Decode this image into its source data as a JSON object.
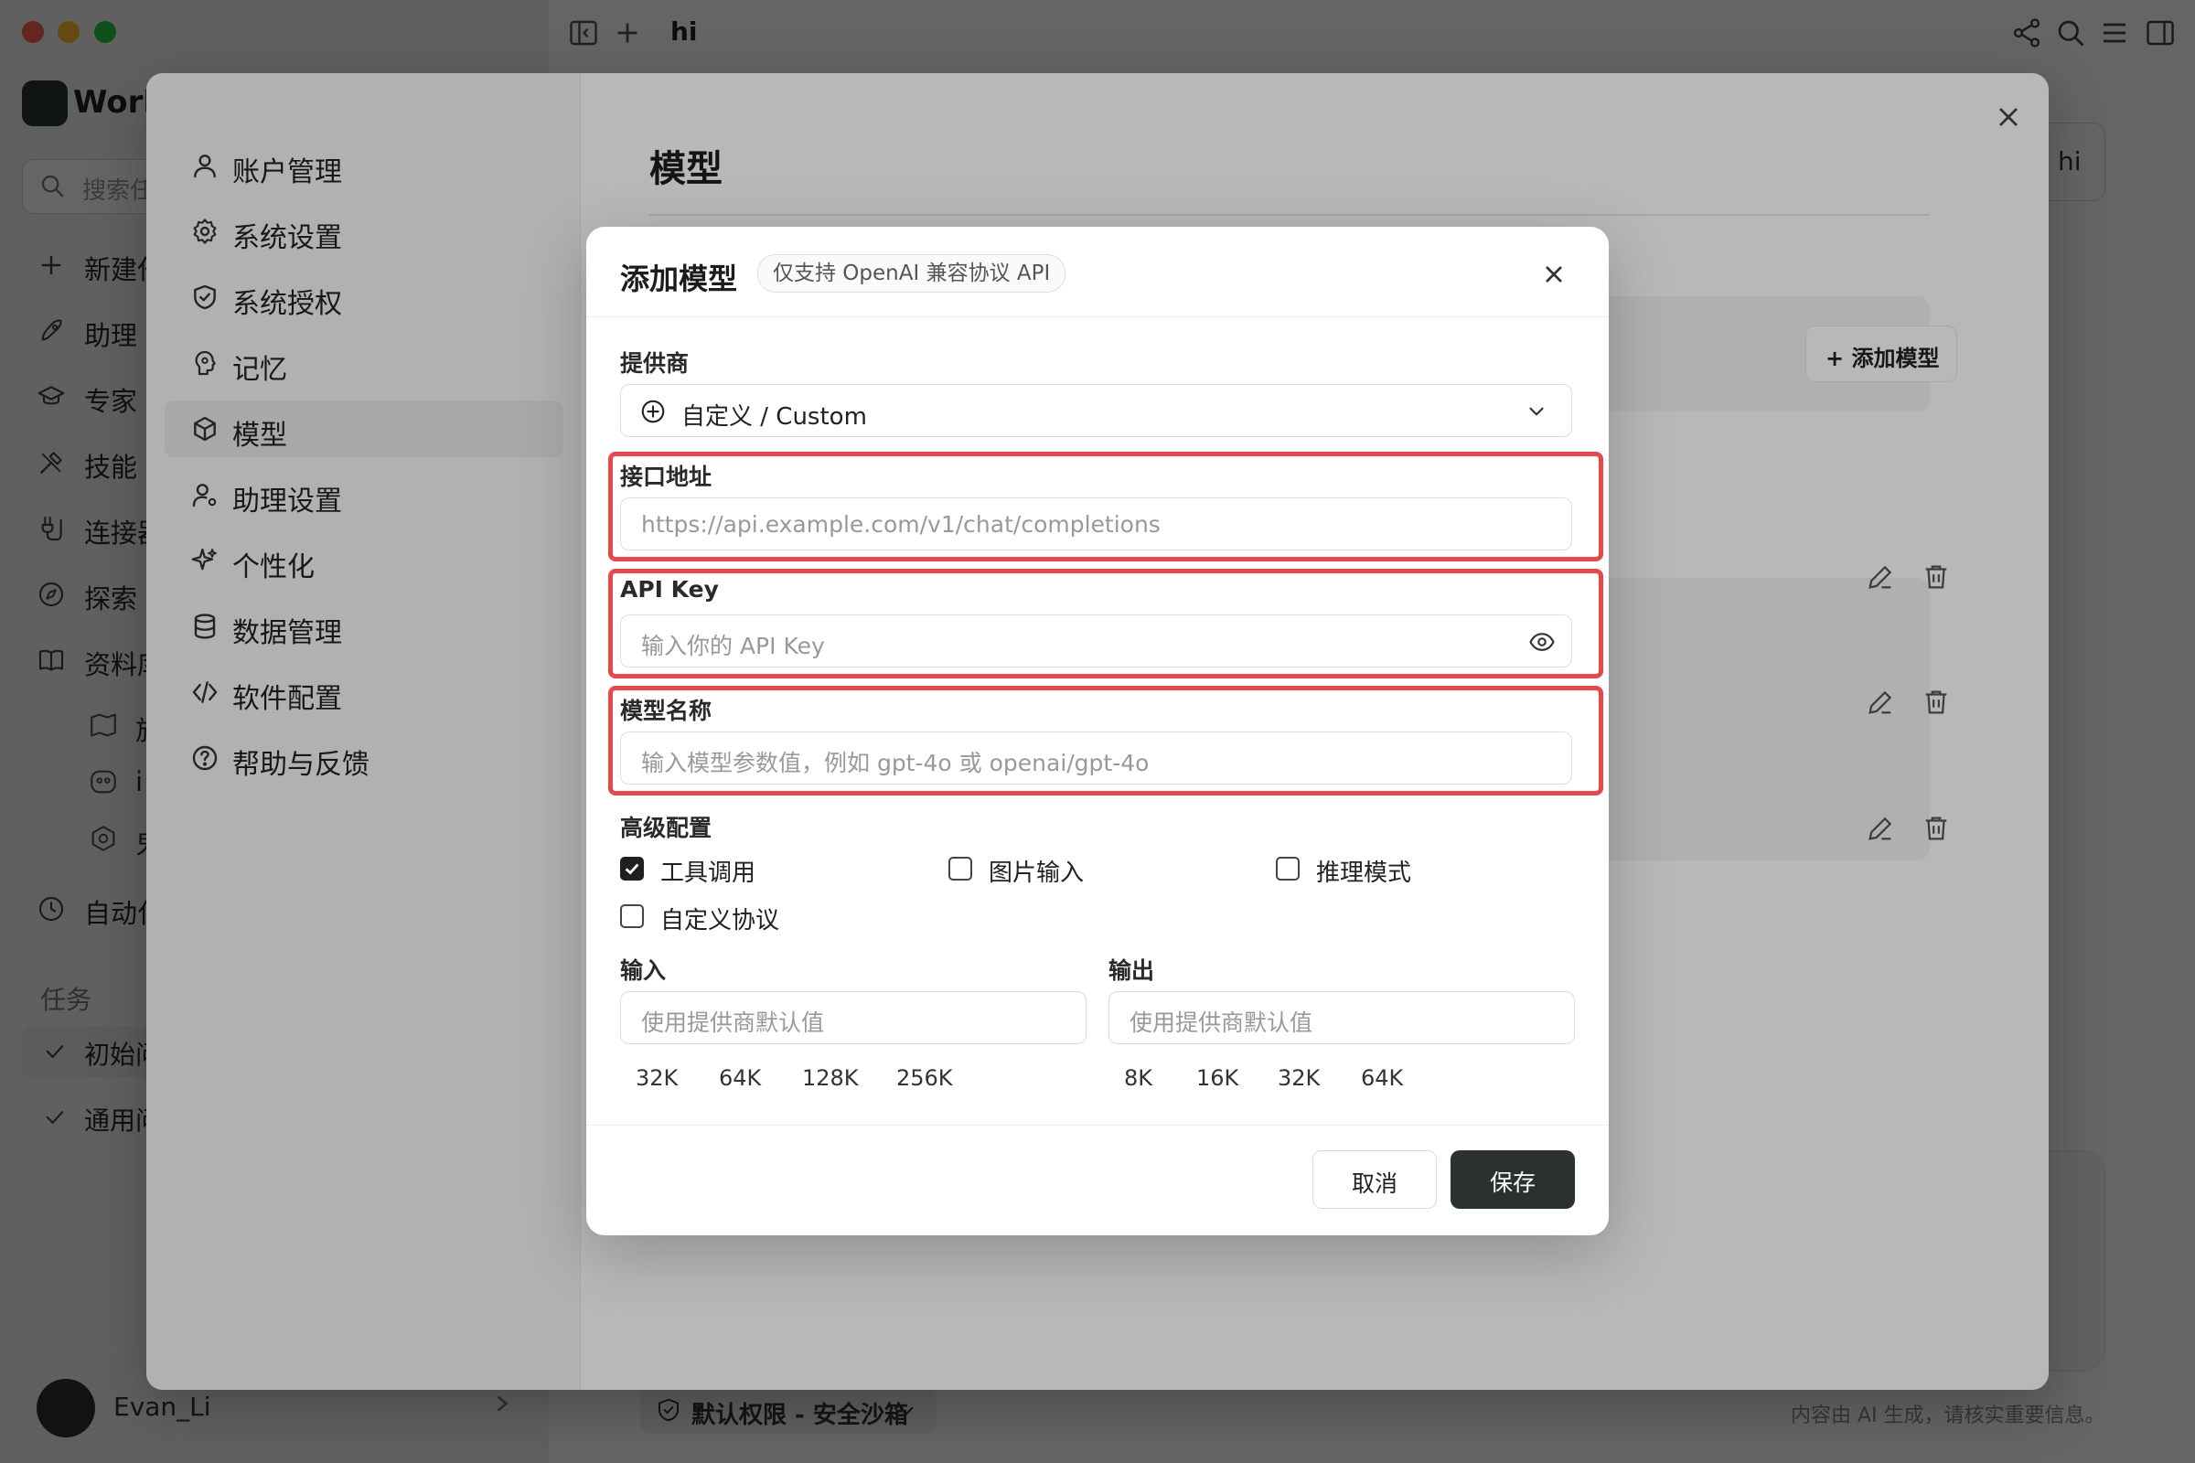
{
  "titlebar": {
    "tab_title": "hi"
  },
  "app_sidebar": {
    "brand": "Work",
    "search_placeholder": "搜索任",
    "nav": [
      {
        "label": "新建任",
        "icon": "plus-icon"
      },
      {
        "label": "助理",
        "icon": "rocket-icon"
      },
      {
        "label": "专家",
        "icon": "graduation-cap-icon"
      },
      {
        "label": "技能",
        "icon": "tools-icon"
      },
      {
        "label": "连接器",
        "icon": "plug-icon"
      },
      {
        "label": "探索",
        "icon": "compass-icon"
      },
      {
        "label": "资料库",
        "icon": "book-icon"
      }
    ],
    "sub_items": [
      "旅",
      "i",
      "鬼"
    ],
    "automation": "自动化",
    "tasks_label": "任务",
    "tasks": [
      "初始问",
      "通用问"
    ],
    "user_name": "Evan_Li"
  },
  "main": {
    "hi_label": "hi",
    "permission": "默认权限 - 安全沙箱",
    "disclaimer": "内容由 AI 生成，请核实重要信息。"
  },
  "settings": {
    "title": "模型",
    "add_model_label": "+ 添加模型",
    "menu": [
      {
        "label": "账户管理",
        "icon": "user-icon",
        "active": false
      },
      {
        "label": "系统设置",
        "icon": "gear-icon",
        "active": false
      },
      {
        "label": "系统授权",
        "icon": "shield-check-icon",
        "active": false
      },
      {
        "label": "记忆",
        "icon": "brain-icon",
        "active": false
      },
      {
        "label": "模型",
        "icon": "cube-icon",
        "active": true
      },
      {
        "label": "助理设置",
        "icon": "user-cog-icon",
        "active": false
      },
      {
        "label": "个性化",
        "icon": "sparkles-icon",
        "active": false
      },
      {
        "label": "数据管理",
        "icon": "database-icon",
        "active": false
      },
      {
        "label": "软件配置",
        "icon": "code-icon",
        "active": false
      },
      {
        "label": "帮助与反馈",
        "icon": "help-circle-icon",
        "active": false
      }
    ]
  },
  "dialog": {
    "title": "添加模型",
    "badge": "仅支持 OpenAI 兼容协议 API",
    "provider_label": "提供商",
    "provider_value": "自定义 / Custom",
    "endpoint_label": "接口地址",
    "endpoint_placeholder": "https://api.example.com/v1/chat/completions",
    "apikey_label": "API Key",
    "apikey_placeholder": "输入你的 API Key",
    "model_name_label": "模型名称",
    "model_name_placeholder": "输入模型参数值，例如 gpt-4o 或 openai/gpt-4o",
    "advanced_label": "高级配置",
    "options": [
      {
        "label": "工具调用",
        "checked": true
      },
      {
        "label": "图片输入",
        "checked": false
      },
      {
        "label": "推理模式",
        "checked": false
      },
      {
        "label": "自定义协议",
        "checked": false
      }
    ],
    "input_label": "输入",
    "input_placeholder": "使用提供商默认值",
    "input_presets": [
      "32K",
      "64K",
      "128K",
      "256K"
    ],
    "output_label": "输出",
    "output_placeholder": "使用提供商默认值",
    "output_presets": [
      "8K",
      "16K",
      "32K",
      "64K"
    ],
    "cancel_label": "取消",
    "save_label": "保存"
  },
  "colors": {
    "highlight": "#e5484d",
    "primary_button": "#2b312f"
  }
}
